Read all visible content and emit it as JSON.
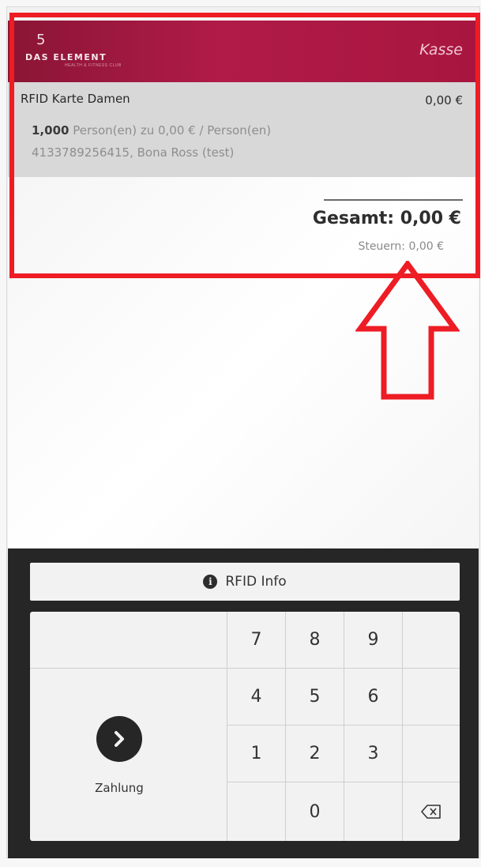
{
  "header": {
    "logo_text": "DAS ELEMENT",
    "logo_subtext": "HEALTH & FITNESS CLUB",
    "title": "Kasse"
  },
  "order": {
    "item_name": "RFID Karte Damen",
    "item_price": "0,00 €",
    "quantity": "1,000",
    "unit_text": "Person(en) zu 0,00 € / Person(en)",
    "reference": "4133789256415, Bona Ross (test)"
  },
  "totals": {
    "total": "Gesamt: 0,00 €",
    "tax": "Steuern: 0,00 €"
  },
  "actions": {
    "rfid_info_label": "RFID Info",
    "pay_label": "Zahlung"
  },
  "keypad": {
    "keys": [
      "7",
      "8",
      "9",
      "",
      "4",
      "5",
      "6",
      "",
      "1",
      "2",
      "3",
      "",
      "",
      "0",
      "",
      "⌫"
    ]
  },
  "annotation": {
    "color": "#ee1c24"
  },
  "colors": {
    "brand": "#a8163f",
    "dark": "#262626"
  }
}
